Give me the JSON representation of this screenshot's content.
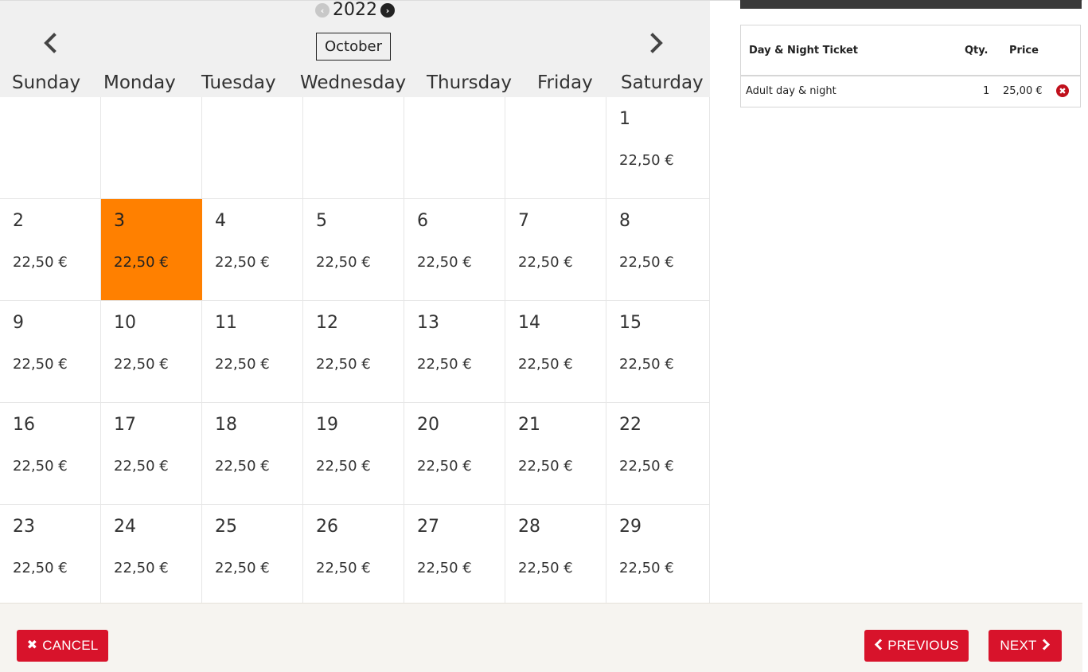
{
  "calendar": {
    "year": "2022",
    "month": "October",
    "weekdays": [
      "Sunday",
      "Monday",
      "Tuesday",
      "Wednesday",
      "Thursday",
      "Friday",
      "Saturday"
    ],
    "selected_day": "3",
    "weeks": [
      [
        null,
        null,
        null,
        null,
        null,
        null,
        {
          "day": "1",
          "price": "22,50 €"
        }
      ],
      [
        {
          "day": "2",
          "price": "22,50 €"
        },
        {
          "day": "3",
          "price": "22,50 €"
        },
        {
          "day": "4",
          "price": "22,50 €"
        },
        {
          "day": "5",
          "price": "22,50 €"
        },
        {
          "day": "6",
          "price": "22,50 €"
        },
        {
          "day": "7",
          "price": "22,50 €"
        },
        {
          "day": "8",
          "price": "22,50 €"
        }
      ],
      [
        {
          "day": "9",
          "price": "22,50 €"
        },
        {
          "day": "10",
          "price": "22,50 €"
        },
        {
          "day": "11",
          "price": "22,50 €"
        },
        {
          "day": "12",
          "price": "22,50 €"
        },
        {
          "day": "13",
          "price": "22,50 €"
        },
        {
          "day": "14",
          "price": "22,50 €"
        },
        {
          "day": "15",
          "price": "22,50 €"
        }
      ],
      [
        {
          "day": "16",
          "price": "22,50 €"
        },
        {
          "day": "17",
          "price": "22,50 €"
        },
        {
          "day": "18",
          "price": "22,50 €"
        },
        {
          "day": "19",
          "price": "22,50 €"
        },
        {
          "day": "20",
          "price": "22,50 €"
        },
        {
          "day": "21",
          "price": "22,50 €"
        },
        {
          "day": "22",
          "price": "22,50 €"
        }
      ],
      [
        {
          "day": "23",
          "price": "22,50 €"
        },
        {
          "day": "24",
          "price": "22,50 €"
        },
        {
          "day": "25",
          "price": "22,50 €"
        },
        {
          "day": "26",
          "price": "22,50 €"
        },
        {
          "day": "27",
          "price": "22,50 €"
        },
        {
          "day": "28",
          "price": "22,50 €"
        },
        {
          "day": "29",
          "price": "22,50 €"
        }
      ]
    ]
  },
  "cart": {
    "header": {
      "name": "Day & Night Ticket",
      "qty": "Qty.",
      "price": "Price"
    },
    "rows": [
      {
        "name": "Adult day & night",
        "qty": "1",
        "price": "25,00 €"
      }
    ]
  },
  "footer": {
    "cancel_label": "CANCEL",
    "previous_label": "PREVIOUS",
    "next_label": "NEXT"
  },
  "colors": {
    "selected_day": "#ff8000",
    "button": "#d8132b",
    "header_bg": "#f0f0f0",
    "cart_bar": "#3a3a3a"
  }
}
